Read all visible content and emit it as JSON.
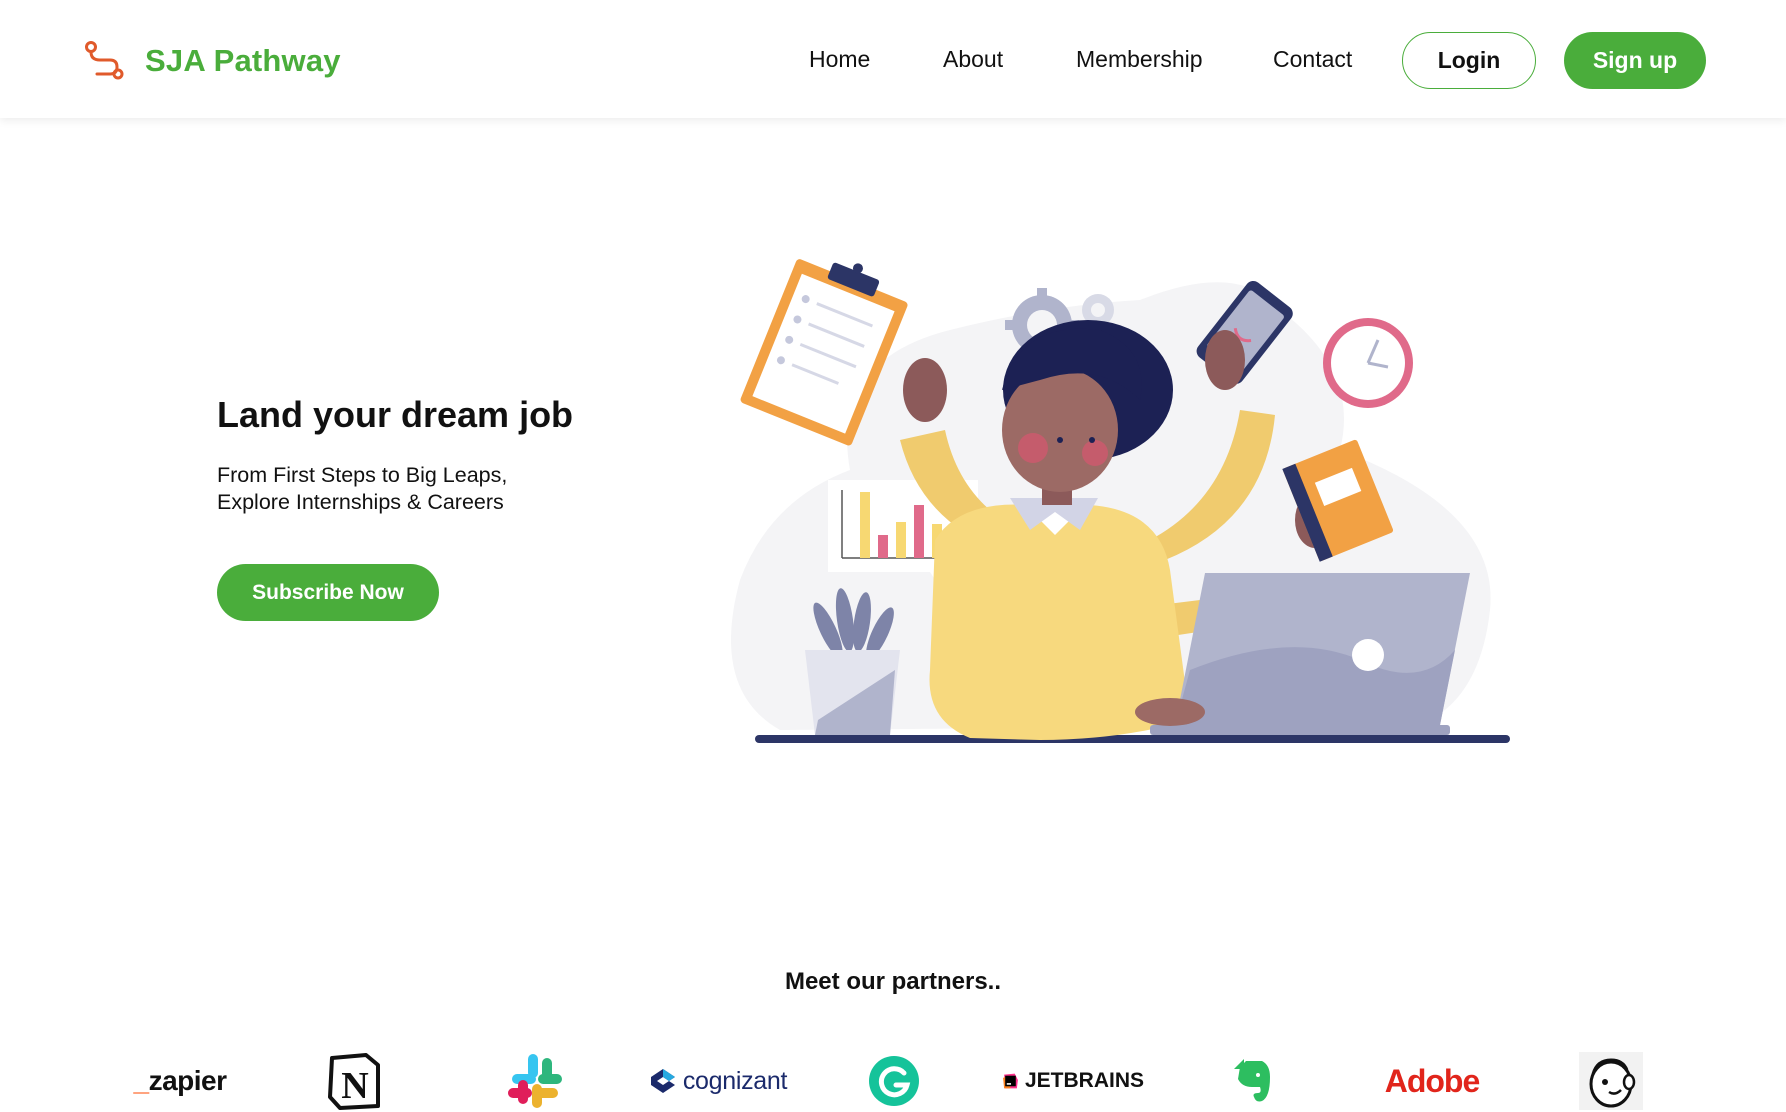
{
  "brand": {
    "name": "SJA Pathway",
    "icon": "route-icon",
    "color": "#4aad3b",
    "icon_color": "#e05a2b"
  },
  "nav": {
    "links": [
      {
        "label": "Home"
      },
      {
        "label": "About"
      },
      {
        "label": "Membership"
      },
      {
        "label": "Contact"
      }
    ],
    "login_label": "Login",
    "signup_label": "Sign up"
  },
  "hero": {
    "title": "Land your dream job",
    "subtitle_line1": "From First Steps to Big Leaps,",
    "subtitle_line2": "Explore Internships & Careers",
    "cta_label": "Subscribe Now",
    "illustration": "multitasking-woman-illustration"
  },
  "partners": {
    "title": "Meet our partners..",
    "logos": [
      {
        "name": "zapier",
        "text_prefix": "_",
        "text": "zapier"
      },
      {
        "name": "notion",
        "text": "N"
      },
      {
        "name": "slack"
      },
      {
        "name": "cognizant",
        "text": "cognizant"
      },
      {
        "name": "grammarly"
      },
      {
        "name": "jetbrains",
        "text": "JETBRAINS"
      },
      {
        "name": "evernote"
      },
      {
        "name": "adobe",
        "text": "Adobe"
      },
      {
        "name": "mailchimp"
      }
    ]
  },
  "colors": {
    "accent": "#4aad3b",
    "text": "#111111",
    "background": "#ffffff"
  }
}
